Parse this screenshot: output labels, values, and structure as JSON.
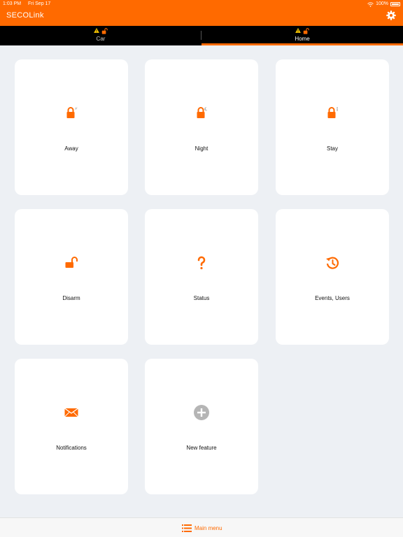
{
  "status_bar": {
    "time": "1:03 PM",
    "date": "Fri Sep 17",
    "battery": "100%"
  },
  "header": {
    "logo": "SECOLink"
  },
  "tabs": [
    {
      "label": "Car",
      "active": false
    },
    {
      "label": "Home",
      "active": true
    }
  ],
  "tiles": [
    {
      "label": "Away",
      "icon": "lock-away-icon"
    },
    {
      "label": "Night",
      "icon": "lock-night-icon"
    },
    {
      "label": "Stay",
      "icon": "lock-stay-icon"
    },
    {
      "label": "Disarm",
      "icon": "unlock-icon"
    },
    {
      "label": "Status",
      "icon": "question-icon"
    },
    {
      "label": "Events, Users",
      "icon": "history-icon"
    },
    {
      "label": "Notifications",
      "icon": "envelope-icon"
    },
    {
      "label": "New feature",
      "icon": "plus-circle-icon"
    }
  ],
  "footer": {
    "main_menu_label": "Main menu"
  },
  "colors": {
    "accent": "#ff6a00",
    "background": "#edf0f4",
    "tab_bar": "#000000",
    "warning": "#f5c400",
    "new_feature_icon": "#b5b5b5"
  }
}
